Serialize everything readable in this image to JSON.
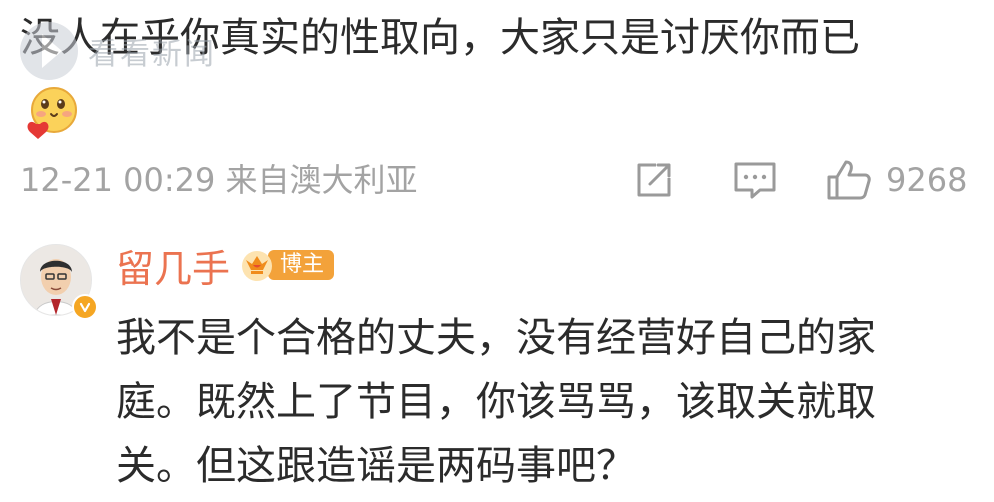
{
  "comment": {
    "text": "没人在乎你真实的性取向，大家只是讨厌你而已",
    "emoji": "heart-face-emoji",
    "time_source": "12-21 00:29 来自澳大利亚",
    "like_count": "9268"
  },
  "watermark": {
    "text": "看看新闻"
  },
  "reply": {
    "author": "留几手",
    "badge": "博主",
    "lines": [
      "我不是个合格的丈夫，没有经营好自己的家",
      "庭。既然上了节目，你该骂骂，该取关就取",
      "关。但这跟造谣是两码事吧？"
    ]
  },
  "colors": {
    "text": "#2b2b2b",
    "meta": "#a3a3a3",
    "author": "#eb7350",
    "badge": "#f3a23a"
  }
}
